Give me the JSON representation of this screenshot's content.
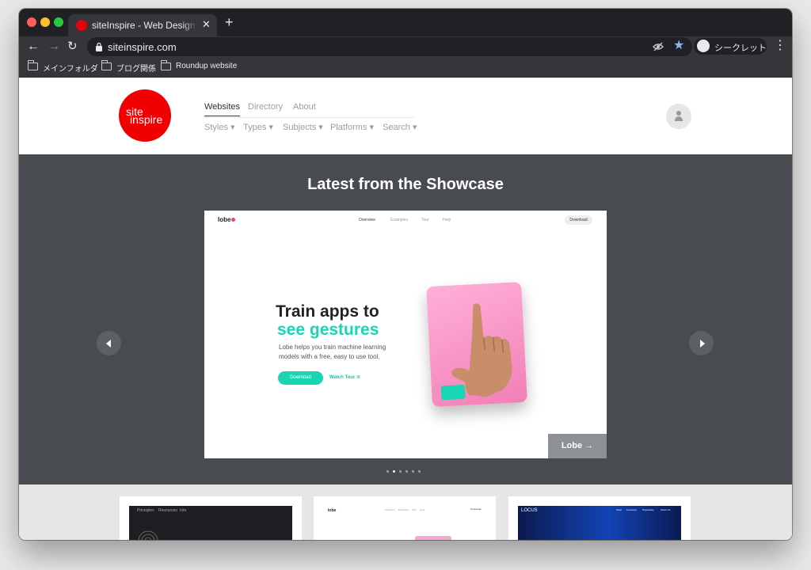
{
  "browser": {
    "tab_title": "siteInspire - Web Design Inspiration",
    "tab_close": "✕",
    "new_tab": "+",
    "url": "siteinspire.com",
    "incognito_label": "シークレット",
    "bookmarks": [
      "メインフォルダ",
      "ブログ関係",
      "Roundup website"
    ],
    "icons": [
      "back-arrow-icon",
      "forward-arrow-icon",
      "reload-icon",
      "lock-icon",
      "eye-off-icon",
      "star-icon",
      "incognito-icon",
      "menu-dots-icon",
      "folder-icon"
    ]
  },
  "site": {
    "logo_line1": "site",
    "logo_line2": "inspire",
    "nav_primary": [
      "Websites",
      "Directory",
      "About"
    ],
    "nav_secondary": [
      "Styles ▾",
      "Types ▾",
      "Subjects ▾",
      "Platforms ▾",
      "Search ▾"
    ],
    "brand_color": "#f00000"
  },
  "showcase": {
    "title": "Latest from the Showcase",
    "slide_label": "Lobe →",
    "dots_total": 6,
    "dots_active_index": 1,
    "slide": {
      "logo": "lobe",
      "nav": [
        "Overview",
        "Examples",
        "Tour",
        "Help"
      ],
      "download_top": "Download",
      "headline_1": "Train apps to",
      "headline_2": "see gestures",
      "description": "Lobe helps you train machine learning models with a free, easy to use tool.",
      "download_button": "Download",
      "watch_tour": "Watch Tour ⊙",
      "accent_color": "#18d6b4"
    }
  },
  "thumbnails": [
    {
      "nav": [
        "Principles",
        "Resources",
        "Info"
      ]
    },
    {
      "logo": "lobe",
      "nav": [
        "Overview",
        "Examples",
        "Tour",
        "Help"
      ],
      "button": "Download"
    },
    {
      "logo": "LOCUS",
      "nav": [
        "Shop",
        "Licensing",
        "Proprietary",
        "About Us"
      ]
    }
  ]
}
